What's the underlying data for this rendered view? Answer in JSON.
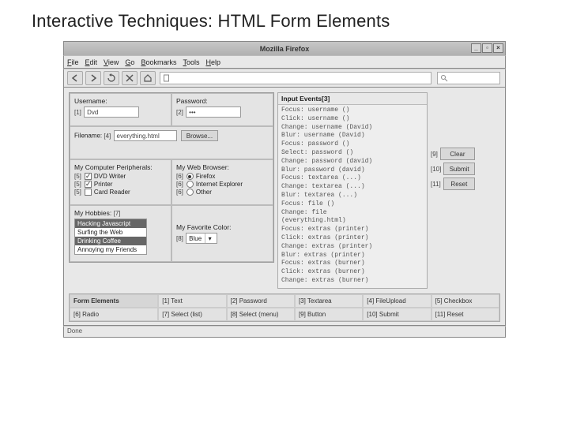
{
  "slide": {
    "title": "Interactive Techniques: HTML Form Elements"
  },
  "window": {
    "title": "Mozilla Firefox",
    "btn_min": "_",
    "btn_max": "▫",
    "btn_close": "×"
  },
  "menu": {
    "items": [
      "File",
      "Edit",
      "View",
      "Go",
      "Bookmarks",
      "Tools",
      "Help"
    ]
  },
  "toolbar": {
    "url": "",
    "search": ""
  },
  "form": {
    "username_label": "Username:",
    "username_tag": "[1]",
    "username_value": "Dvd",
    "password_label": "Password:",
    "password_tag": "[2]",
    "password_value": "•••",
    "filename_label": "Filename:",
    "filename_tag": "[4]",
    "filename_field": "everything.html",
    "browse_btn": "Browse...",
    "peripherals_label": "My Computer Peripherals:",
    "peripherals_items": [
      {
        "tag": "[5]",
        "label": "DVD Writer",
        "checked": true
      },
      {
        "tag": "[5]",
        "label": "Printer",
        "checked": true
      },
      {
        "tag": "[5]",
        "label": "Card Reader",
        "checked": false
      }
    ],
    "browser_label": "My Web Browser:",
    "browser_items": [
      {
        "tag": "[6]",
        "label": "Firefox",
        "checked": true
      },
      {
        "tag": "[6]",
        "label": "Internet Explorer",
        "checked": false
      },
      {
        "tag": "[6]",
        "label": "Other",
        "checked": false
      }
    ],
    "hobbies_label": "My Hobbies:",
    "hobbies_tag": "[7]",
    "hobbies_items": [
      {
        "label": "Hacking Javascript",
        "selected": true
      },
      {
        "label": "Surfing the Web",
        "selected": false
      },
      {
        "label": "Drinking Coffee",
        "selected": true
      },
      {
        "label": "Annoying my Friends",
        "selected": false
      }
    ],
    "favcolor_label": "My Favorite Color:",
    "favcolor_tag": "[8]",
    "favcolor_value": "Blue",
    "dd_arrow": "▾"
  },
  "events": {
    "header": "Input Events[3]",
    "log": "Focus: username ()\nClick: username ()\nChange: username (David)\nBlur: username (David)\nFocus: password ()\nSelect: password ()\nChange: password (david)\nBlur: password (david)\nFocus: textarea (...)\nChange: textarea (...)\nBlur: textarea (...)\nFocus: file ()\nChange: file\n(everything.html)\nFocus: extras (printer)\nClick: extras (printer)\nChange: extras (printer)\nBlur: extras (printer)\nFocus: extras (burner)\nClick: extras (burner)\nChange: extras (burner)"
  },
  "sidebuttons": [
    {
      "tag": "[9]",
      "label": "Clear"
    },
    {
      "tag": "[10]",
      "label": "Submit"
    },
    {
      "tag": "[11]",
      "label": "Reset"
    }
  ],
  "legend": {
    "header": "Form Elements",
    "items": [
      "[1] Text",
      "[2] Password",
      "[3] Textarea",
      "[4] FileUpload",
      "[5] Checkbox",
      "[6] Radio",
      "[7] Select (list)",
      "[8] Select (menu)",
      "[9] Button",
      "[10] Submit",
      "[11] Reset"
    ]
  },
  "status": {
    "text": "Done"
  }
}
